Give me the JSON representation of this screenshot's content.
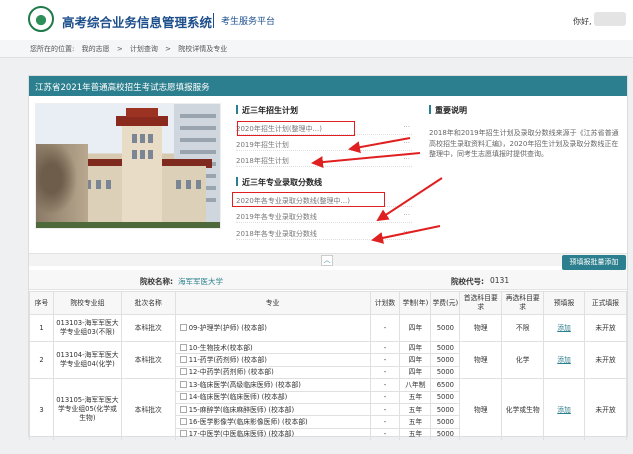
{
  "header": {
    "title": "高考综合业务信息管理系统",
    "subtitle": "考生服务平台",
    "greeting": "你好,"
  },
  "breadcrumb": {
    "prefix": "您所在的位置:",
    "items": [
      "我的志愿",
      "计划查询",
      "院校详情及专业"
    ],
    "separator": ">"
  },
  "panel": {
    "title": "江苏省2021年普通高校招生考试志愿填报服务"
  },
  "plans": {
    "title": "近三年招生计划",
    "items": [
      "2020年招生计划(整理中...)",
      "2019年招生计划",
      "2018年招生计划"
    ]
  },
  "scores": {
    "title": "近三年专业录取分数线",
    "items": [
      "2020年各专业录取分数线(整理中...)",
      "2019年各专业录取分数线",
      "2018年各专业录取分数线"
    ]
  },
  "notice": {
    "title": "重要说明",
    "text": "2018年和2019年招生计划及录取分数线来源于《江苏省普通高校招生录取资料汇编》，2020年招生计划及录取分数线正在整理中，同考生志愿填报时提供查询。"
  },
  "dots": "···",
  "toggle_icon": "chevron-up-icon",
  "toggle_glyph": "︿",
  "fill_button": "预填报批量添加",
  "school": {
    "name_label": "院校名称:",
    "name": "海军军医大学",
    "code_label": "院校代号:",
    "code": "0131"
  },
  "table": {
    "headers": [
      "序号",
      "院校专业组",
      "批次名称",
      "专业",
      "计划数",
      "学制(年)",
      "学费(元)",
      "首选科目要求",
      "再选科目要求",
      "预填报",
      "正式填报"
    ],
    "groups": [
      {
        "index": "1",
        "group": "013103-海军军医大学专业组03(不限)",
        "batch": "本科批次",
        "first": "物理",
        "second": "不限",
        "prefill": "添加",
        "formal": "未开放",
        "majors": [
          {
            "name": "09-护理学(护师)  (校本部)",
            "plan": "-",
            "years": "四年",
            "fee": "5000"
          }
        ]
      },
      {
        "index": "2",
        "group": "013104-海军军医大学专业组04(化学)",
        "batch": "本科批次",
        "first": "物理",
        "second": "化学",
        "prefill": "添加",
        "formal": "未开放",
        "majors": [
          {
            "name": "10-生物技术(校本部)",
            "plan": "-",
            "years": "四年",
            "fee": "5000"
          },
          {
            "name": "11-药学(药剂师)  (校本部)",
            "plan": "-",
            "years": "四年",
            "fee": "5000"
          },
          {
            "name": "12-中药学(药剂师)  (校本部)",
            "plan": "-",
            "years": "四年",
            "fee": "5000"
          }
        ]
      },
      {
        "index": "3",
        "group": "013105-海军军医大学专业组05(化学或生物)",
        "batch": "本科批次",
        "first": "物理",
        "second": "化学或生物",
        "prefill": "添加",
        "formal": "未开放",
        "majors": [
          {
            "name": "13-临床医学(高级临床医师)  (校本部)",
            "plan": "-",
            "years": "八年制",
            "fee": "6500"
          },
          {
            "name": "14-临床医学(临床医师)  (校本部)",
            "plan": "-",
            "years": "五年",
            "fee": "5000"
          },
          {
            "name": "15-麻醉学(临床麻醉医师)  (校本部)",
            "plan": "-",
            "years": "五年",
            "fee": "5000"
          },
          {
            "name": "16-医学影像学(临床影像医师)  (校本部)",
            "plan": "-",
            "years": "五年",
            "fee": "5000"
          },
          {
            "name": "17-中医学(中医临床医师)  (校本部)",
            "plan": "-",
            "years": "五年",
            "fee": "5000"
          }
        ]
      }
    ]
  },
  "colors": {
    "brand": "#1d4f8c",
    "accent": "#2c7f8e",
    "annotation_red": "#e02020"
  }
}
